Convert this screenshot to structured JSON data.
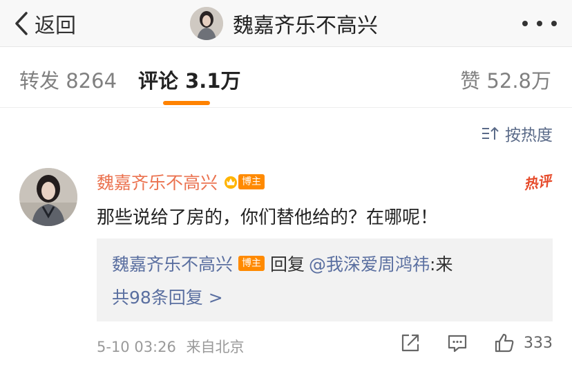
{
  "nav": {
    "back_label": "返回",
    "title": "魏嘉齐乐不高兴"
  },
  "tabs": [
    {
      "label": "转发 8264",
      "active": false
    },
    {
      "label": "评论 3.1万",
      "active": true
    },
    {
      "label": "赞 52.8万",
      "active": false
    }
  ],
  "sort": {
    "label": "按热度"
  },
  "comment": {
    "author": "魏嘉齐乐不高兴",
    "badge": "博主",
    "hot_tag": "热评",
    "text": "那些说给了房的，你们替他给的？在哪呢！",
    "reply": {
      "author": "魏嘉齐乐不高兴",
      "badge": "博主",
      "verb": "回复",
      "mention": "@我深爱周鸿祎",
      "text": ":来"
    },
    "more_replies": "共98条回复 >",
    "time": "5-10 03:26",
    "source": "来自北京",
    "like_count": "333"
  },
  "colors": {
    "accent": "#ff8200",
    "name": "#eb7350",
    "link": "#5a6fa0",
    "hot": "#e64a2a",
    "badge": "#ff8a00"
  },
  "icons": [
    "back-chevron-icon",
    "more-dots-icon",
    "sort-icon",
    "share-icon",
    "comment-icon",
    "like-icon",
    "crown-icon"
  ]
}
